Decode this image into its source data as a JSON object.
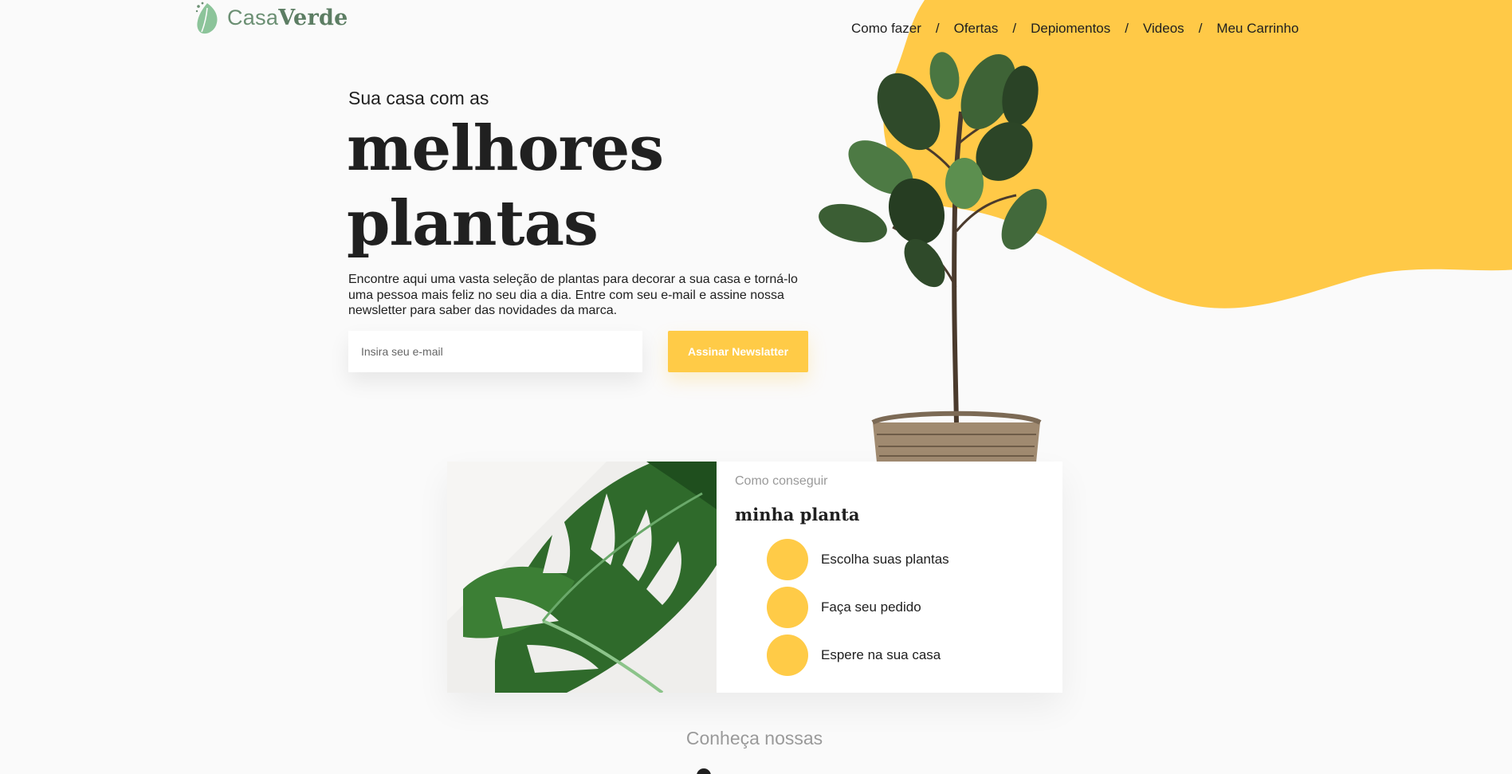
{
  "brand": {
    "name_light": "Casa",
    "name_bold": "Verde",
    "color": "#6b8f73"
  },
  "nav": {
    "items": [
      "Como fazer",
      "Ofertas",
      "Depiomentos",
      "Videos",
      "Meu Carrinho"
    ],
    "separator": "/"
  },
  "hero": {
    "pre": "Sua casa com as",
    "title_line1": "melhores",
    "title_line2": "plantas",
    "description": "Encontre aqui uma vasta seleção de plantas para decorar a sua casa e torná-lo uma pessoa mais feliz no seu dia a dia. Entre com seu e-mail e assine nossa newsletter para saber das novidades da marca.",
    "email_placeholder": "Insira seu e-mail",
    "email_value": "",
    "button_label": "Assinar Newslatter",
    "accent_color": "#ffcb47"
  },
  "how_to": {
    "pre": "Como conseguir",
    "title": "minha planta",
    "steps": [
      "Escolha suas plantas",
      "Faça seu pedido",
      "Espere na sua casa"
    ]
  },
  "section": {
    "subtitle": "Conheça nossas"
  }
}
